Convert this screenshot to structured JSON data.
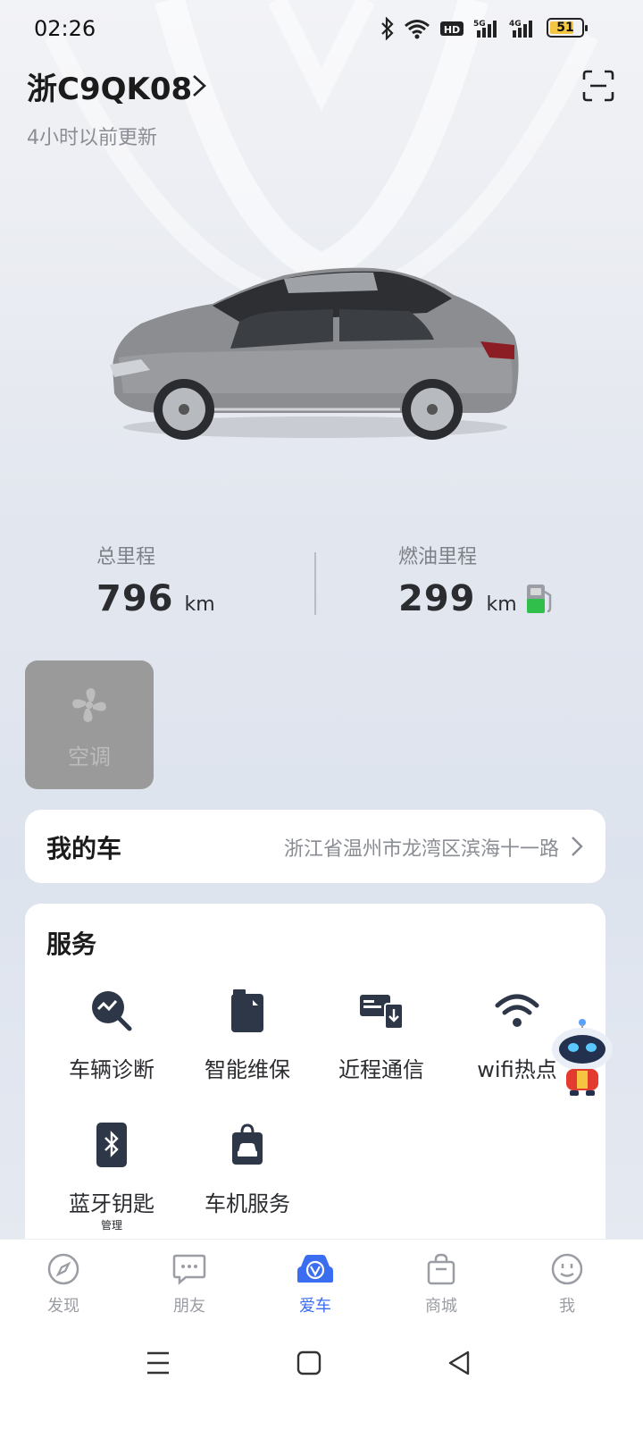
{
  "status_bar": {
    "time": "02:26",
    "icons": [
      "bluetooth-icon",
      "wifi-icon",
      "hd-icon",
      "signal-5g-icon",
      "signal-4g-icon"
    ],
    "battery_level": "51"
  },
  "vehicle": {
    "plate": "浙C9QK08",
    "updated": "4小时以前更新"
  },
  "stats": {
    "total_mileage_label": "总里程",
    "total_mileage_value": "796",
    "total_mileage_unit": "km",
    "fuel_range_label": "燃油里程",
    "fuel_range_value": "299",
    "fuel_range_unit": "km"
  },
  "quick_actions": {
    "ac_label": "空调"
  },
  "my_car": {
    "title": "我的车",
    "address": "浙江省温州市龙湾区滨海十一路"
  },
  "services": {
    "title": "服务",
    "items": [
      {
        "label": "车辆诊断",
        "icon": "diagnosis-icon"
      },
      {
        "label": "智能维保",
        "icon": "maintenance-icon"
      },
      {
        "label": "近程通信",
        "icon": "short-range-comm-icon"
      },
      {
        "label": "wifi热点",
        "icon": "wifi-hotspot-icon"
      },
      {
        "label": "蓝牙钥匙",
        "sub": "管理",
        "icon": "bluetooth-key-icon"
      },
      {
        "label": "车机服务",
        "icon": "car-service-icon"
      }
    ]
  },
  "bottom_nav": {
    "items": [
      {
        "label": "发现",
        "icon": "compass-icon"
      },
      {
        "label": "朋友",
        "icon": "chat-icon"
      },
      {
        "label": "爱车",
        "icon": "car-icon",
        "active": true
      },
      {
        "label": "商城",
        "icon": "shopping-bag-icon"
      },
      {
        "label": "我",
        "icon": "smile-icon"
      }
    ]
  },
  "colors": {
    "accent": "#3a6df0",
    "fuel_green": "#2fbf4a",
    "battery_yellow": "#f4c742"
  }
}
